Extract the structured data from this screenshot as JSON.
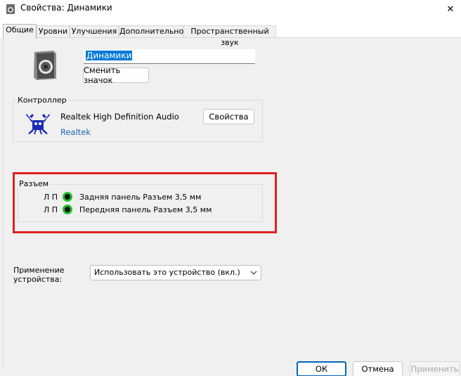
{
  "window": {
    "title": "Свойства: Динамики",
    "close_glyph": "✕"
  },
  "tabs": [
    {
      "label": "Общие",
      "active": true
    },
    {
      "label": "Уровни",
      "active": false
    },
    {
      "label": "Улучшения",
      "active": false
    },
    {
      "label": "Дополнительно",
      "active": false
    },
    {
      "label": "Пространственный звук",
      "active": false
    }
  ],
  "device": {
    "icon": "speaker-icon",
    "name_value": "Динамики",
    "change_icon_label": "Сменить значок"
  },
  "controller": {
    "group_label": "Контроллер",
    "name": "Realtek High Definition Audio",
    "vendor": "Realtek",
    "properties_label": "Свойства",
    "logo": "realtek-crab-logo"
  },
  "jack": {
    "group_label": "Разъем",
    "rows": [
      {
        "channels": "Л П",
        "label": "Задняя панель Разъем 3,5 мм"
      },
      {
        "channels": "Л П",
        "label": "Передняя панель Разъем 3,5 мм"
      }
    ],
    "dot_color": "#22c22e"
  },
  "usage": {
    "label_line1": "Применение",
    "label_line2": "устройства:",
    "selected": "Использовать это устройство (вкл.)"
  },
  "buttons": {
    "ok": "ОК",
    "cancel": "Отмена",
    "apply": "Применить"
  },
  "colors": {
    "highlight_frame": "#e02020",
    "accent": "#0067c0",
    "link": "#2563b0"
  }
}
